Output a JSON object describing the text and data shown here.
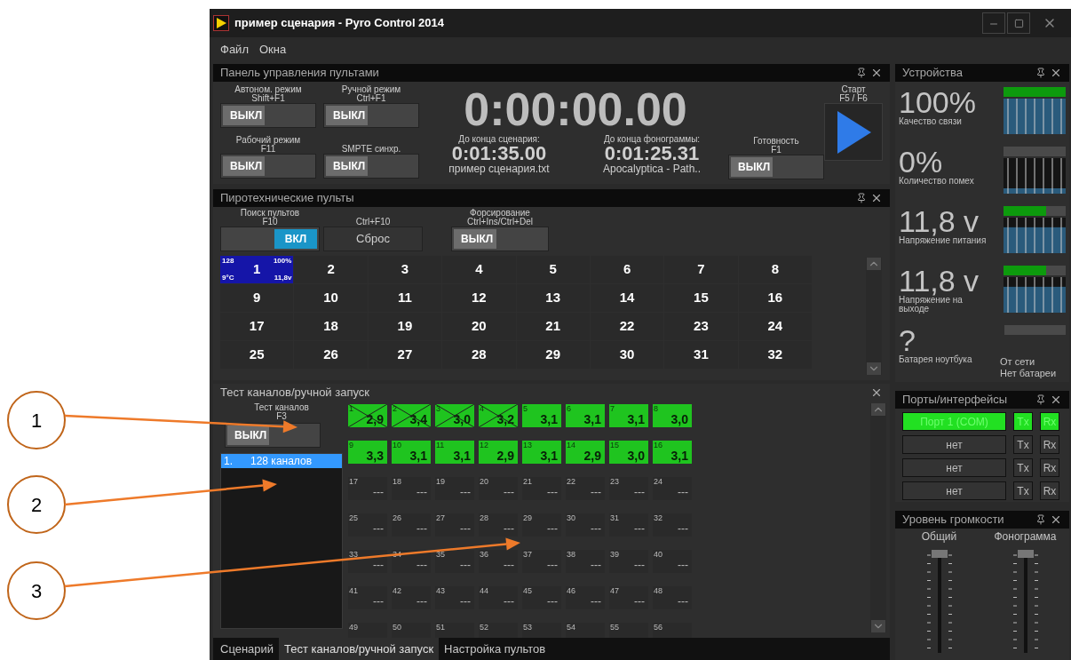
{
  "window": {
    "title": "пример сценария - Pyro Control 2014"
  },
  "menu": [
    "Файл",
    "Окна"
  ],
  "control_panel": {
    "title": "Панель управления пультами",
    "toggles": [
      {
        "label": "Автоном. режим",
        "shortcut": "Shift+F1",
        "state_label": "ВЫКЛ",
        "on": false
      },
      {
        "label": "Ручной режим",
        "shortcut": "Ctrl+F1",
        "state_label": "ВЫКЛ",
        "on": false
      },
      {
        "label": "Рабочий режим",
        "shortcut": "F11",
        "state_label": "ВЫКЛ",
        "on": false
      },
      {
        "label": "SMPTE синхр.",
        "state_label": "ВЫКЛ",
        "on": false
      }
    ],
    "timer": "0:00:00.00",
    "countdowns": [
      {
        "label": "До конца сценария:",
        "time": "0:01:35.00",
        "name": "пример сценария.txt"
      },
      {
        "label": "До конца фонограммы:",
        "time": "0:01:25.31",
        "name": "Apocalyptica - Path.."
      }
    ],
    "ready": {
      "label": "Готовность",
      "shortcut": "F1",
      "state_label": "ВЫКЛ",
      "on": false
    },
    "start": {
      "label": "Старт",
      "shortcut": "F5 / F6"
    }
  },
  "pyro_panel": {
    "title": "Пиротехнические пульты",
    "search": {
      "label": "Поиск пультов",
      "shortcut": "F10",
      "state_label": "ВКЛ",
      "on": true
    },
    "reset": {
      "shortcut": "Ctrl+F10",
      "label": "Сброс"
    },
    "force": {
      "label": "Форсирование",
      "shortcut": "Ctrl+Ins/Ctrl+Del",
      "state_label": "ВЫКЛ",
      "on": false
    },
    "consoles": [
      {
        "number": "1",
        "selected": true,
        "channels": "128",
        "quality": "100%",
        "temperature": "9°C",
        "voltage": "11,8v"
      },
      {
        "number": "2",
        "selected": false
      },
      {
        "number": "3",
        "selected": false
      },
      {
        "number": "4",
        "selected": false
      },
      {
        "number": "5",
        "selected": false
      },
      {
        "number": "6",
        "selected": false
      },
      {
        "number": "7",
        "selected": false
      },
      {
        "number": "8",
        "selected": false
      },
      {
        "number": "9",
        "selected": false
      },
      {
        "number": "10",
        "selected": false
      },
      {
        "number": "11",
        "selected": false
      },
      {
        "number": "12",
        "selected": false
      },
      {
        "number": "13",
        "selected": false
      },
      {
        "number": "14",
        "selected": false
      },
      {
        "number": "15",
        "selected": false
      },
      {
        "number": "16",
        "selected": false
      },
      {
        "number": "17",
        "selected": false
      },
      {
        "number": "18",
        "selected": false
      },
      {
        "number": "19",
        "selected": false
      },
      {
        "number": "20",
        "selected": false
      },
      {
        "number": "21",
        "selected": false
      },
      {
        "number": "22",
        "selected": false
      },
      {
        "number": "23",
        "selected": false
      },
      {
        "number": "24",
        "selected": false
      },
      {
        "number": "25",
        "selected": false
      },
      {
        "number": "26",
        "selected": false
      },
      {
        "number": "27",
        "selected": false
      },
      {
        "number": "28",
        "selected": false
      },
      {
        "number": "29",
        "selected": false
      },
      {
        "number": "30",
        "selected": false
      },
      {
        "number": "31",
        "selected": false
      },
      {
        "number": "32",
        "selected": false
      }
    ]
  },
  "channel_test": {
    "title": "Тест каналов/ручной запуск",
    "toggle": {
      "label": "Тест каналов",
      "shortcut": "F3",
      "state_label": "ВЫКЛ",
      "on": false
    },
    "console_list": [
      {
        "index": "1.",
        "label": "128 каналов",
        "selected": true
      }
    ],
    "channels": [
      {
        "number": "1",
        "reading": "2,9",
        "tested": true,
        "crossed": true
      },
      {
        "number": "2",
        "reading": "3,4",
        "tested": true,
        "crossed": true
      },
      {
        "number": "3",
        "reading": "3,0",
        "tested": true,
        "crossed": true
      },
      {
        "number": "4",
        "reading": "3,2",
        "tested": true,
        "crossed": true
      },
      {
        "number": "5",
        "reading": "3,1",
        "tested": true,
        "crossed": false
      },
      {
        "number": "6",
        "reading": "3,1",
        "tested": true,
        "crossed": false
      },
      {
        "number": "7",
        "reading": "3,1",
        "tested": true,
        "crossed": false
      },
      {
        "number": "8",
        "reading": "3,0",
        "tested": true,
        "crossed": false
      },
      {
        "number": "9",
        "reading": "3,3",
        "tested": true,
        "crossed": false
      },
      {
        "number": "10",
        "reading": "3,1",
        "tested": true,
        "crossed": false
      },
      {
        "number": "11",
        "reading": "3,1",
        "tested": true,
        "crossed": false
      },
      {
        "number": "12",
        "reading": "2,9",
        "tested": true,
        "crossed": false
      },
      {
        "number": "13",
        "reading": "3,1",
        "tested": true,
        "crossed": false
      },
      {
        "number": "14",
        "reading": "2,9",
        "tested": true,
        "crossed": false
      },
      {
        "number": "15",
        "reading": "3,0",
        "tested": true,
        "crossed": false
      },
      {
        "number": "16",
        "reading": "3,1",
        "tested": true,
        "crossed": false
      },
      {
        "number": "17",
        "reading": "---",
        "tested": false,
        "crossed": false
      },
      {
        "number": "18",
        "reading": "---",
        "tested": false,
        "crossed": false
      },
      {
        "number": "19",
        "reading": "---",
        "tested": false,
        "crossed": false
      },
      {
        "number": "20",
        "reading": "---",
        "tested": false,
        "crossed": false
      },
      {
        "number": "21",
        "reading": "---",
        "tested": false,
        "crossed": false
      },
      {
        "number": "22",
        "reading": "---",
        "tested": false,
        "crossed": false
      },
      {
        "number": "23",
        "reading": "---",
        "tested": false,
        "crossed": false
      },
      {
        "number": "24",
        "reading": "---",
        "tested": false,
        "crossed": false
      },
      {
        "number": "25",
        "reading": "---",
        "tested": false,
        "crossed": false
      },
      {
        "number": "26",
        "reading": "---",
        "tested": false,
        "crossed": false
      },
      {
        "number": "27",
        "reading": "---",
        "tested": false,
        "crossed": false
      },
      {
        "number": "28",
        "reading": "---",
        "tested": false,
        "crossed": false
      },
      {
        "number": "29",
        "reading": "---",
        "tested": false,
        "crossed": false
      },
      {
        "number": "30",
        "reading": "---",
        "tested": false,
        "crossed": false
      },
      {
        "number": "31",
        "reading": "---",
        "tested": false,
        "crossed": false
      },
      {
        "number": "32",
        "reading": "---",
        "tested": false,
        "crossed": false
      },
      {
        "number": "33",
        "reading": "---",
        "tested": false,
        "crossed": false
      },
      {
        "number": "34",
        "reading": "---",
        "tested": false,
        "crossed": false
      },
      {
        "number": "35",
        "reading": "---",
        "tested": false,
        "crossed": false
      },
      {
        "number": "36",
        "reading": "---",
        "tested": false,
        "crossed": false
      },
      {
        "number": "37",
        "reading": "---",
        "tested": false,
        "crossed": false
      },
      {
        "number": "38",
        "reading": "---",
        "tested": false,
        "crossed": false
      },
      {
        "number": "39",
        "reading": "---",
        "tested": false,
        "crossed": false
      },
      {
        "number": "40",
        "reading": "---",
        "tested": false,
        "crossed": false
      },
      {
        "number": "41",
        "reading": "---",
        "tested": false,
        "crossed": false
      },
      {
        "number": "42",
        "reading": "---",
        "tested": false,
        "crossed": false
      },
      {
        "number": "43",
        "reading": "---",
        "tested": false,
        "crossed": false
      },
      {
        "number": "44",
        "reading": "---",
        "tested": false,
        "crossed": false
      },
      {
        "number": "45",
        "reading": "---",
        "tested": false,
        "crossed": false
      },
      {
        "number": "46",
        "reading": "---",
        "tested": false,
        "crossed": false
      },
      {
        "number": "47",
        "reading": "---",
        "tested": false,
        "crossed": false
      },
      {
        "number": "48",
        "reading": "---",
        "tested": false,
        "crossed": false
      },
      {
        "number": "49",
        "tested": false,
        "crossed": false
      },
      {
        "number": "50",
        "tested": false,
        "crossed": false
      },
      {
        "number": "51",
        "tested": false,
        "crossed": false
      },
      {
        "number": "52",
        "tested": false,
        "crossed": false
      },
      {
        "number": "53",
        "tested": false,
        "crossed": false
      },
      {
        "number": "54",
        "tested": false,
        "crossed": false
      },
      {
        "number": "55",
        "tested": false,
        "crossed": false
      },
      {
        "number": "56",
        "tested": false,
        "crossed": false
      }
    ]
  },
  "tabs": [
    {
      "label": "Сценарий",
      "selected": false
    },
    {
      "label": "Тест каналов/ручной запуск",
      "selected": true
    },
    {
      "label": "Настройка пультов",
      "selected": false
    }
  ],
  "devices": {
    "title": "Устройства",
    "metrics": [
      {
        "value": "100%",
        "label": "Качество связи",
        "level": 1,
        "kind": "graph"
      },
      {
        "value": "0%",
        "label": "Количество помех",
        "level": 0,
        "kind": "graph"
      },
      {
        "value": "11,8 v",
        "label": "Напряжение питания",
        "level": 0.68,
        "kind": "graph"
      },
      {
        "value": "11,8 v",
        "label": "Напряжение на выходе",
        "level": 0.68,
        "kind": "graph"
      },
      {
        "value": "?",
        "label": "Батарея ноутбука",
        "level": 0,
        "kind": "bar"
      }
    ],
    "power": [
      "От сети",
      "Нет батареи"
    ]
  },
  "ports": {
    "title": "Порты/интерфейсы",
    "items": [
      {
        "name": "Порт 1 (COM)",
        "active": true,
        "tx": "Tx",
        "rx": "Rx"
      },
      {
        "name": "нет",
        "active": false,
        "tx": "Tx",
        "rx": "Rx"
      },
      {
        "name": "нет",
        "active": false,
        "tx": "Tx",
        "rx": "Rx"
      },
      {
        "name": "нет",
        "active": false,
        "tx": "Tx",
        "rx": "Rx"
      }
    ]
  },
  "volume": {
    "title": "Уровень громкости",
    "sliders": [
      {
        "label": "Общий",
        "level": 1
      },
      {
        "label": "Фонограмма",
        "level": 1
      }
    ]
  },
  "callouts": [
    "1",
    "2",
    "3"
  ]
}
